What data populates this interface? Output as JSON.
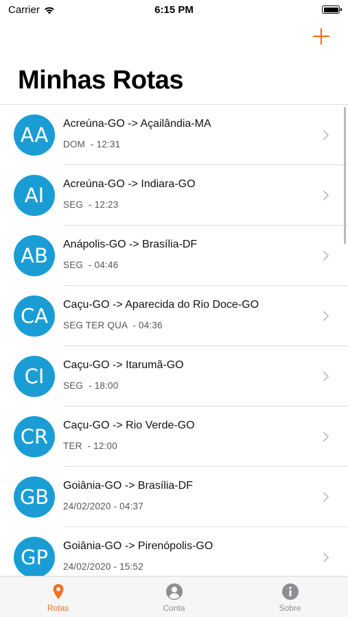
{
  "status_bar": {
    "carrier": "Carrier",
    "time": "6:15 PM"
  },
  "header": {
    "title": "Minhas Rotas",
    "add_icon": "plus-icon"
  },
  "colors": {
    "accent": "#f36f21",
    "avatar": "#1a9dd4",
    "inactive": "#8e8e93"
  },
  "routes": [
    {
      "initials": "AA",
      "title": "Acreúna-GO -> Açailândia-MA",
      "schedule": "DOM  - 12:31"
    },
    {
      "initials": "AI",
      "title": "Acreúna-GO -> Indiara-GO",
      "schedule": "SEG  - 12:23"
    },
    {
      "initials": "AB",
      "title": "Anápolis-GO -> Brasília-DF",
      "schedule": "SEG  - 04:46"
    },
    {
      "initials": "CA",
      "title": "Caçu-GO -> Aparecida do Rio Doce-GO",
      "schedule": "SEG TER QUA  - 04:36"
    },
    {
      "initials": "CI",
      "title": "Caçu-GO -> Itarumã-GO",
      "schedule": "SEG  - 18:00"
    },
    {
      "initials": "CR",
      "title": "Caçu-GO -> Rio Verde-GO",
      "schedule": "TER  - 12:00"
    },
    {
      "initials": "GB",
      "title": "Goiânia-GO -> Brasília-DF",
      "schedule": "24/02/2020 - 04:37"
    },
    {
      "initials": "GP",
      "title": "Goiânia-GO -> Pirenópolis-GO",
      "schedule": "24/02/2020 - 15:52"
    }
  ],
  "tabs": [
    {
      "label": "Rotas",
      "icon": "location-pin-icon",
      "active": true
    },
    {
      "label": "Conta",
      "icon": "person-icon",
      "active": false
    },
    {
      "label": "Sobre",
      "icon": "info-icon",
      "active": false
    }
  ]
}
